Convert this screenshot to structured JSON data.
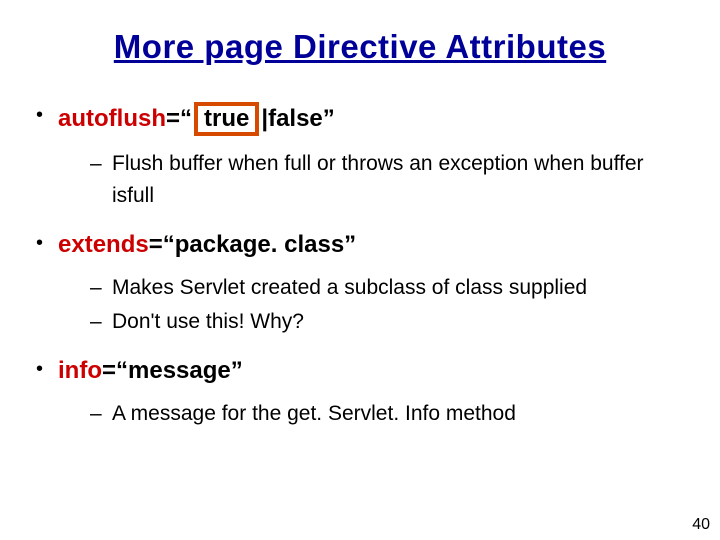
{
  "title": "More page Directive Attributes",
  "bullets": [
    {
      "attr": "autoflush",
      "eq": "=“",
      "boxed": "true",
      "rest": "|false”",
      "subs": [
        "Flush buffer when full or throws an exception when buffer isfull"
      ]
    },
    {
      "attr": "extends",
      "rest": "=“package. class”",
      "subs": [
        "Makes Servlet created a subclass of class supplied",
        "Don't use this! Why?"
      ]
    },
    {
      "attr": "info",
      "rest": "=“message”",
      "subs": [
        "A message for the get. Servlet. Info method"
      ]
    }
  ],
  "page_number": "40",
  "colors": {
    "title": "#000099",
    "attr": "#cc0000",
    "highlight_border": "#d64a00"
  }
}
